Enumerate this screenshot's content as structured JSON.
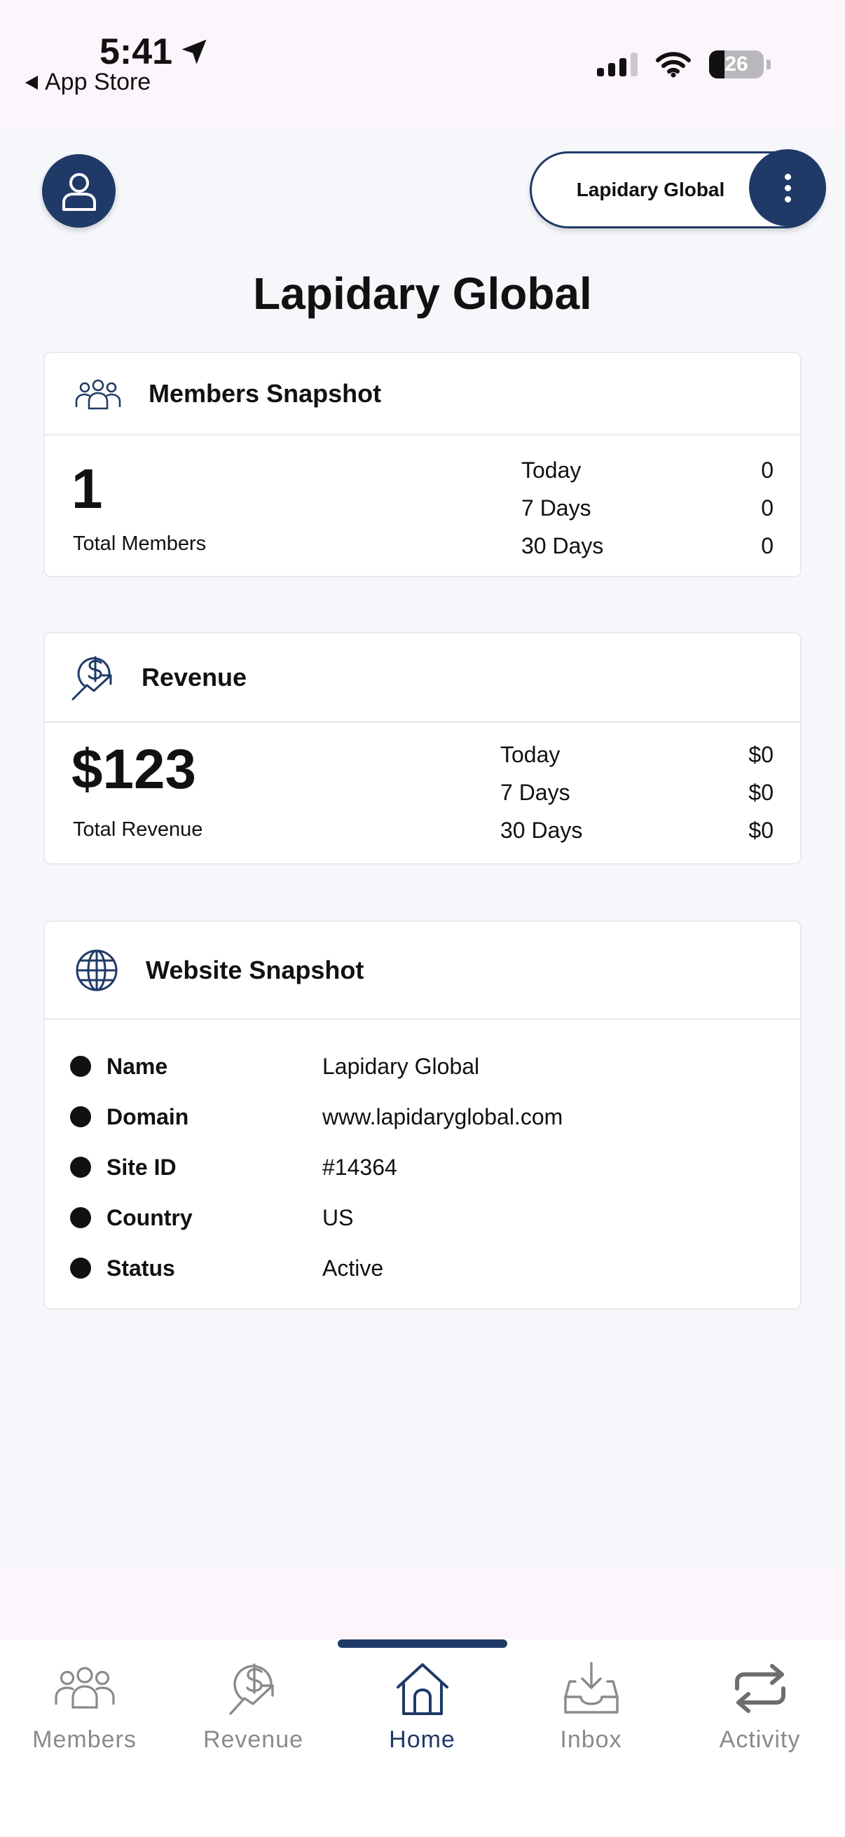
{
  "status_bar": {
    "time": "5:41",
    "back_label": "App Store",
    "battery": "26"
  },
  "header": {
    "site_selector_label": "Lapidary Global",
    "page_title": "Lapidary Global"
  },
  "members_snapshot": {
    "title": "Members Snapshot",
    "total": "1",
    "total_label": "Total Members",
    "rows": [
      {
        "label": "Today",
        "value": "0"
      },
      {
        "label": "7 Days",
        "value": "0"
      },
      {
        "label": "30 Days",
        "value": "0"
      }
    ]
  },
  "revenue": {
    "title": "Revenue",
    "total": "$123",
    "total_label": "Total Revenue",
    "rows": [
      {
        "label": "Today",
        "value": "$0"
      },
      {
        "label": "7 Days",
        "value": "$0"
      },
      {
        "label": "30 Days",
        "value": "$0"
      }
    ]
  },
  "website_snapshot": {
    "title": "Website Snapshot",
    "rows": [
      {
        "key": "Name",
        "value": "Lapidary Global"
      },
      {
        "key": "Domain",
        "value": "www.lapidaryglobal.com"
      },
      {
        "key": "Site ID",
        "value": "#14364"
      },
      {
        "key": "Country",
        "value": "US"
      },
      {
        "key": "Status",
        "value": "Active"
      }
    ]
  },
  "tabbar": {
    "items": [
      {
        "label": "Members",
        "icon": "members-icon"
      },
      {
        "label": "Revenue",
        "icon": "revenue-icon"
      },
      {
        "label": "Home",
        "icon": "home-icon"
      },
      {
        "label": "Inbox",
        "icon": "inbox-icon"
      },
      {
        "label": "Activity",
        "icon": "activity-icon"
      }
    ],
    "active": "Home"
  },
  "colors": {
    "brand": "#1f3a67",
    "background": "#f5f7fa",
    "inactive_tab": "#8a8a8a"
  }
}
